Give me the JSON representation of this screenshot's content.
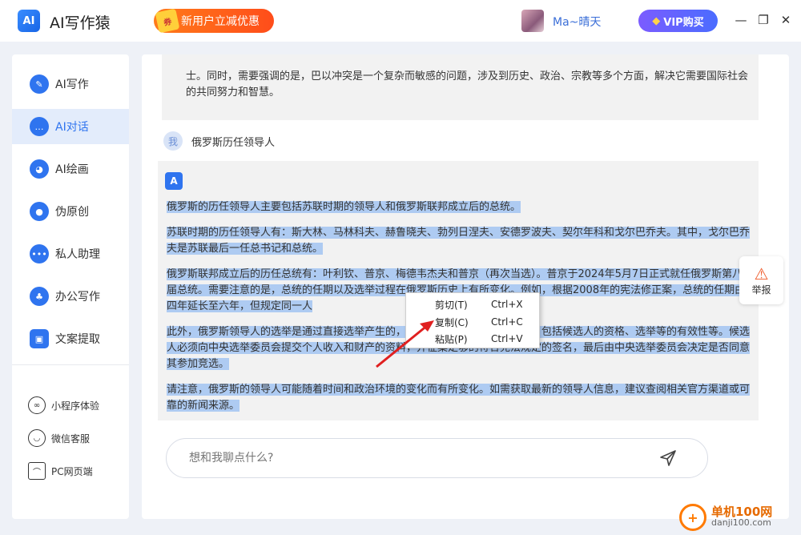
{
  "app": {
    "logo_text": "AI",
    "title": "AI写作猿",
    "promo": "新用户立减优惠",
    "username": "Ma~晴天",
    "vip_label": "VIP购买",
    "window_controls": [
      "minimize",
      "maximize",
      "close"
    ]
  },
  "sidebar": {
    "items": [
      {
        "label": "AI写作",
        "icon": "pen-icon"
      },
      {
        "label": "AI对话",
        "icon": "chat-icon",
        "active": true
      },
      {
        "label": "AI绘画",
        "icon": "palette-icon"
      },
      {
        "label": "伪原创",
        "icon": "bulb-icon"
      },
      {
        "label": "私人助理",
        "icon": "assistant-icon"
      },
      {
        "label": "办公写作",
        "icon": "office-icon"
      },
      {
        "label": "文案提取",
        "icon": "extract-icon"
      }
    ],
    "bottom": [
      {
        "label": "小程序体验",
        "icon": "miniprogram-icon"
      },
      {
        "label": "微信客服",
        "icon": "wechat-service-icon"
      },
      {
        "label": "PC网页端",
        "icon": "pc-web-icon"
      }
    ]
  },
  "chat": {
    "prev_answer_tail": "士。同时，需要强调的是，巴以冲突是一个复杂而敏感的问题，涉及到历史、政治、宗教等多个方面，解决它需要国际社会的共同努力和智慧。",
    "user_avatar": "我",
    "user_message": "俄罗斯历任领导人",
    "ai_badge": "A",
    "answer_paragraphs": [
      "俄罗斯的历任领导人主要包括苏联时期的领导人和俄罗斯联邦成立后的总统。",
      "苏联时期的历任领导人有：斯大林、马林科夫、赫鲁晓夫、勃列日涅夫、安德罗波夫、契尔年科和戈尔巴乔夫。其中，戈尔巴乔夫是苏联最后一任总书记和总统。",
      "俄罗斯联邦成立后的历任总统有：叶利钦、普京、梅德韦杰夫和普京（再次当选）。普京于2024年5月7日正式就任俄罗斯第八届总统。需要注意的是，总统的任期以及选举过程在俄罗斯历史上有所变化。例如，根据2008年的宪法修正案，总统的任期由四年延长至六年，但规定同一人",
      "此外，俄罗斯领导人的选举是通过直接选举产生的，候选人需要经过一系列程序，包括候选人的资格、选举等的有效性等。候选人必须向中央选举委员会提交个人收入和财产的资料，并征集足够的符合宪法规定的签名，最后由中央选举委员会决定是否同意其参加竞选。",
      "请注意，俄罗斯的领导人可能随着时间和政治环境的变化而有所变化。如需获取最新的领导人信息，建议查阅相关官方渠道或可靠的新闻来源。"
    ],
    "report_label": "举报",
    "input_placeholder": "想和我聊点什么?"
  },
  "context_menu": {
    "items": [
      {
        "label": "剪切(T)",
        "shortcut": "Ctrl+X"
      },
      {
        "label": "复制(C)",
        "shortcut": "Ctrl+C"
      },
      {
        "label": "粘贴(P)",
        "shortcut": "Ctrl+V"
      }
    ]
  },
  "watermark": {
    "title": "单机100网",
    "url": "danji100.com"
  },
  "colors": {
    "accent": "#2f74ef",
    "selection": "#aecbf2",
    "promo": "#ff5a1a",
    "vip": "#6a5cff",
    "arrow": "#e02020"
  }
}
